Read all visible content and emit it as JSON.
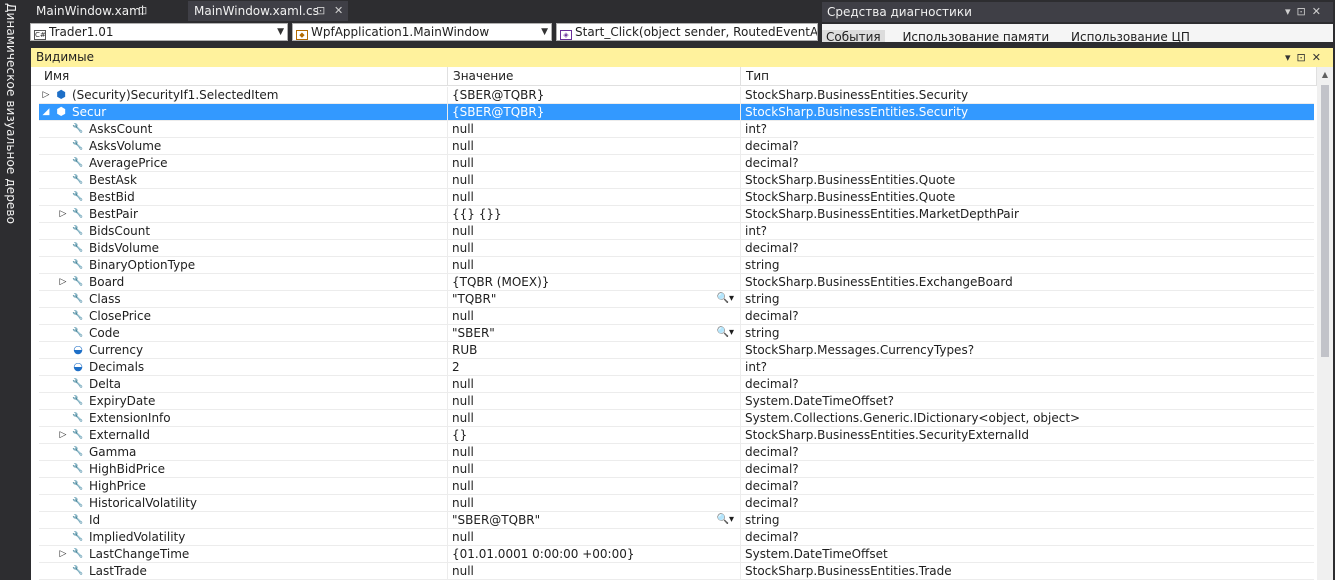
{
  "sidebar": {
    "title": "Динамическое визуальное дерево"
  },
  "tabs": [
    {
      "label": "MainWindow.xaml",
      "icon": "pin-icon"
    },
    {
      "label": "MainWindow.xaml.cs",
      "icon": "pin-icon"
    }
  ],
  "nav": {
    "project": "Trader1.01",
    "class": "WpfApplication1.MainWindow",
    "member": "Start_Click(object sender, RoutedEventArg"
  },
  "diagnostics": {
    "title": "Средства диагностики",
    "tabs": [
      "События",
      "Использование памяти",
      "Использование ЦП"
    ]
  },
  "panel": {
    "title": "Видимые",
    "columns": {
      "name": "Имя",
      "value": "Значение",
      "type": "Тип"
    }
  },
  "rows": [
    {
      "name": "(Security)SecurityIf1.SelectedItem",
      "value": "{SBER@TQBR}",
      "type": "StockSharp.BusinessEntities.Security",
      "level": 0,
      "expand": "collapsed",
      "icon": "object",
      "selected": false,
      "lens": false
    },
    {
      "name": "Secur",
      "value": "{SBER@TQBR}",
      "type": "StockSharp.BusinessEntities.Security",
      "level": 0,
      "expand": "expanded",
      "icon": "object",
      "selected": true,
      "lens": false
    },
    {
      "name": "AsksCount",
      "value": "null",
      "type": "int?",
      "level": 1,
      "expand": "none",
      "icon": "wrench",
      "selected": false,
      "lens": false
    },
    {
      "name": "AsksVolume",
      "value": "null",
      "type": "decimal?",
      "level": 1,
      "expand": "none",
      "icon": "wrench",
      "selected": false,
      "lens": false
    },
    {
      "name": "AveragePrice",
      "value": "null",
      "type": "decimal?",
      "level": 1,
      "expand": "none",
      "icon": "wrench",
      "selected": false,
      "lens": false
    },
    {
      "name": "BestAsk",
      "value": "null",
      "type": "StockSharp.BusinessEntities.Quote",
      "level": 1,
      "expand": "none",
      "icon": "wrench",
      "selected": false,
      "lens": false
    },
    {
      "name": "BestBid",
      "value": "null",
      "type": "StockSharp.BusinessEntities.Quote",
      "level": 1,
      "expand": "none",
      "icon": "wrench",
      "selected": false,
      "lens": false
    },
    {
      "name": "BestPair",
      "value": "{{} {}}",
      "type": "StockSharp.BusinessEntities.MarketDepthPair",
      "level": 1,
      "expand": "collapsed",
      "icon": "wrench",
      "selected": false,
      "lens": false
    },
    {
      "name": "BidsCount",
      "value": "null",
      "type": "int?",
      "level": 1,
      "expand": "none",
      "icon": "wrench",
      "selected": false,
      "lens": false
    },
    {
      "name": "BidsVolume",
      "value": "null",
      "type": "decimal?",
      "level": 1,
      "expand": "none",
      "icon": "wrench",
      "selected": false,
      "lens": false
    },
    {
      "name": "BinaryOptionType",
      "value": "null",
      "type": "string",
      "level": 1,
      "expand": "none",
      "icon": "wrench",
      "selected": false,
      "lens": false
    },
    {
      "name": "Board",
      "value": "{TQBR (MOEX)}",
      "type": "StockSharp.BusinessEntities.ExchangeBoard",
      "level": 1,
      "expand": "collapsed",
      "icon": "wrench",
      "selected": false,
      "lens": false
    },
    {
      "name": "Class",
      "value": "\"TQBR\"",
      "type": "string",
      "level": 1,
      "expand": "none",
      "icon": "wrench",
      "selected": false,
      "lens": true
    },
    {
      "name": "ClosePrice",
      "value": "null",
      "type": "decimal?",
      "level": 1,
      "expand": "none",
      "icon": "wrench",
      "selected": false,
      "lens": false
    },
    {
      "name": "Code",
      "value": "\"SBER\"",
      "type": "string",
      "level": 1,
      "expand": "none",
      "icon": "wrench",
      "selected": false,
      "lens": true
    },
    {
      "name": "Currency",
      "value": "RUB",
      "type": "StockSharp.Messages.CurrencyTypes?",
      "level": 1,
      "expand": "none",
      "icon": "enum",
      "selected": false,
      "lens": false
    },
    {
      "name": "Decimals",
      "value": "2",
      "type": "int?",
      "level": 1,
      "expand": "none",
      "icon": "enum",
      "selected": false,
      "lens": false
    },
    {
      "name": "Delta",
      "value": "null",
      "type": "decimal?",
      "level": 1,
      "expand": "none",
      "icon": "wrench",
      "selected": false,
      "lens": false
    },
    {
      "name": "ExpiryDate",
      "value": "null",
      "type": "System.DateTimeOffset?",
      "level": 1,
      "expand": "none",
      "icon": "wrench",
      "selected": false,
      "lens": false
    },
    {
      "name": "ExtensionInfo",
      "value": "null",
      "type": "System.Collections.Generic.IDictionary<object, object>",
      "level": 1,
      "expand": "none",
      "icon": "wrench",
      "selected": false,
      "lens": false
    },
    {
      "name": "ExternalId",
      "value": "{}",
      "type": "StockSharp.BusinessEntities.SecurityExternalId",
      "level": 1,
      "expand": "collapsed",
      "icon": "wrench",
      "selected": false,
      "lens": false
    },
    {
      "name": "Gamma",
      "value": "null",
      "type": "decimal?",
      "level": 1,
      "expand": "none",
      "icon": "wrench",
      "selected": false,
      "lens": false
    },
    {
      "name": "HighBidPrice",
      "value": "null",
      "type": "decimal?",
      "level": 1,
      "expand": "none",
      "icon": "wrench",
      "selected": false,
      "lens": false
    },
    {
      "name": "HighPrice",
      "value": "null",
      "type": "decimal?",
      "level": 1,
      "expand": "none",
      "icon": "wrench",
      "selected": false,
      "lens": false
    },
    {
      "name": "HistoricalVolatility",
      "value": "null",
      "type": "decimal?",
      "level": 1,
      "expand": "none",
      "icon": "wrench",
      "selected": false,
      "lens": false
    },
    {
      "name": "Id",
      "value": "\"SBER@TQBR\"",
      "type": "string",
      "level": 1,
      "expand": "none",
      "icon": "wrench",
      "selected": false,
      "lens": true
    },
    {
      "name": "ImpliedVolatility",
      "value": "null",
      "type": "decimal?",
      "level": 1,
      "expand": "none",
      "icon": "wrench",
      "selected": false,
      "lens": false
    },
    {
      "name": "LastChangeTime",
      "value": "{01.01.0001 0:00:00 +00:00}",
      "type": "System.DateTimeOffset",
      "level": 1,
      "expand": "collapsed",
      "icon": "wrench",
      "selected": false,
      "lens": false
    },
    {
      "name": "LastTrade",
      "value": "null",
      "type": "StockSharp.BusinessEntities.Trade",
      "level": 1,
      "expand": "none",
      "icon": "wrench",
      "selected": false,
      "lens": false
    }
  ],
  "colors": {
    "selection": "#3399ff",
    "panel_header": "#fff29d",
    "chrome": "#2d2d30",
    "object_icon": "#1e6fc7",
    "enum_icon": "#1e6fc7"
  }
}
